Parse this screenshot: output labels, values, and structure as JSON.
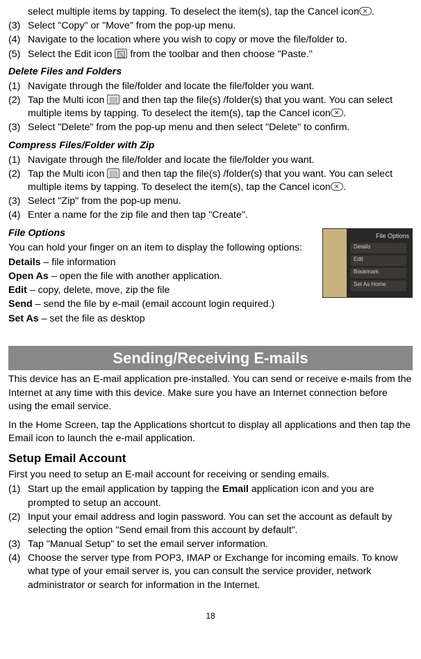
{
  "top": {
    "line_a": "select multiple items by tapping. To deselect the item(s), tap the Cancel icon",
    "line_a_end": ".",
    "s3_num": "(3)",
    "s3_txt": "Select \"Copy\" or \"Move\" from the pop-up menu.",
    "s4_num": "(4)",
    "s4_txt": "Navigate to the location where you wish to copy or move the file/folder to.",
    "s5_num": "(5)",
    "s5_a": "Select the Edit icon ",
    "s5_b": " from the toolbar and then choose \"Paste.\""
  },
  "del": {
    "title": "Delete Files and Folders",
    "s1_num": "(1)",
    "s1_txt": "Navigate through the file/folder and locate the file/folder you want.",
    "s2_num": "(2)",
    "s2_a": "Tap the Multi icon ",
    "s2_b": " and then tap the file(s) /folder(s) that you want. You can select multiple items by tapping. To deselect the item(s), tap the Cancel icon",
    "s2_c": ".",
    "s3_num": "(3)",
    "s3_txt": "Select \"Delete\" from the pop-up menu and then select \"Delete\" to confirm."
  },
  "zip": {
    "title": "Compress Files/Folder with Zip",
    "s1_num": "(1)",
    "s1_txt": "Navigate through the file/folder and locate the file/folder you want.",
    "s2_num": "(2)",
    "s2_a": "Tap the Multi icon ",
    "s2_b": " and then tap the file(s) /folder(s) that you want. You can select multiple items by tapping. To deselect the item(s), tap the Cancel icon",
    "s2_c": ".",
    "s3_num": "(3)",
    "s3_txt": "Select \"Zip\" from the pop-up menu.",
    "s4_num": "(4)",
    "s4_txt": "Enter a name for the zip file and then tap \"Create\"."
  },
  "opts": {
    "title": "File Options",
    "intro_a": "You can hold your finger on an item to display the following options:",
    "details_l": "Details",
    "details_t": " – file information",
    "openas_l": "Open As",
    "openas_t": " – open the file with another application.",
    "edit_l": "Edit",
    "edit_t": " – copy, delete, move, zip the file",
    "send_l": "Send",
    "send_t": " – send the file by e-mail (email account login required.)",
    "setas_l": "Set As",
    "setas_t": " – set the file as desktop",
    "thumb_title": "File Options",
    "thumb_i1": "Details",
    "thumb_i2": "Edit",
    "thumb_i3": "Bookmark",
    "thumb_i4": "Set As Home"
  },
  "email": {
    "bar": "Sending/Receiving E-mails",
    "p1": "This device has an E-mail application pre-installed. You can send or receive e-mails from the Internet at any time with this device. Make sure you have an Internet connection before using the email service.",
    "p2": "In the Home Screen, tap the Applications shortcut to display all applications and then tap the Email icon to launch the e-mail application.",
    "setup_head": "Setup Email Account",
    "setup_intro": "First you need to setup an E-mail account for receiving or sending emails.",
    "s1_num": "(1)",
    "s1_a": "Start up the email application by tapping the ",
    "s1_bold": "Email",
    "s1_b": " application icon and you are prompted to setup an account.",
    "s2_num": "(2)",
    "s2_txt": "Input your email address and login password. You can set the account as default by selecting the option \"Send email from this account by default\".",
    "s3_num": "(3)",
    "s3_txt": "Tap \"Manual Setup\" to set the email server information.",
    "s4_num": "(4)",
    "s4_txt": "Choose the server type from POP3, IMAP or Exchange for incoming emails. To know what type of your email server is, you can consult the service provider, network administrator or search for information in the Internet."
  },
  "page_number": "18"
}
